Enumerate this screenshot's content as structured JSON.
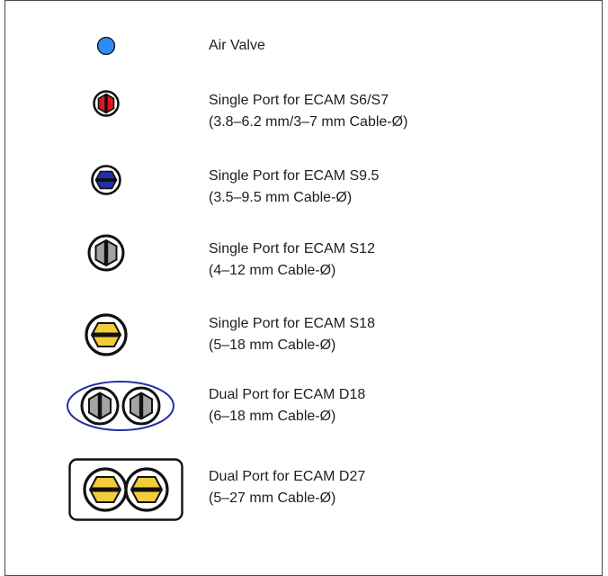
{
  "legend": {
    "items": [
      {
        "icon": "air-valve-icon",
        "lines": [
          "Air Valve"
        ],
        "color": "#2f8cf6"
      },
      {
        "icon": "single-port-s6-s7-icon",
        "lines": [
          "Single Port for ECAM S6/S7",
          "(3.8–6.2 mm/3–7 mm Cable-Ø)"
        ],
        "color": "#e0161c"
      },
      {
        "icon": "single-port-s9-5-icon",
        "lines": [
          "Single Port for ECAM S9.5",
          "(3.5–9.5 mm Cable-Ø)"
        ],
        "color": "#2430a6"
      },
      {
        "icon": "single-port-s12-icon",
        "lines": [
          "Single Port for ECAM S12",
          "(4–12 mm Cable-Ø)"
        ],
        "color": "#a3a3a3"
      },
      {
        "icon": "single-port-s18-icon",
        "lines": [
          "Single Port for ECAM S18",
          "(5–18 mm Cable-Ø)"
        ],
        "color": "#f2cc3a"
      },
      {
        "icon": "dual-port-d18-icon",
        "lines": [
          "Dual Port for ECAM D18",
          "(6–18 mm Cable-Ø)"
        ],
        "color": "#a3a3a3",
        "outline": "#2630a0"
      },
      {
        "icon": "dual-port-d27-icon",
        "lines": [
          "Dual Port for ECAM D27",
          "(5–27 mm Cable-Ø)"
        ],
        "color": "#f2cc3a",
        "outline": "#000000"
      }
    ]
  }
}
